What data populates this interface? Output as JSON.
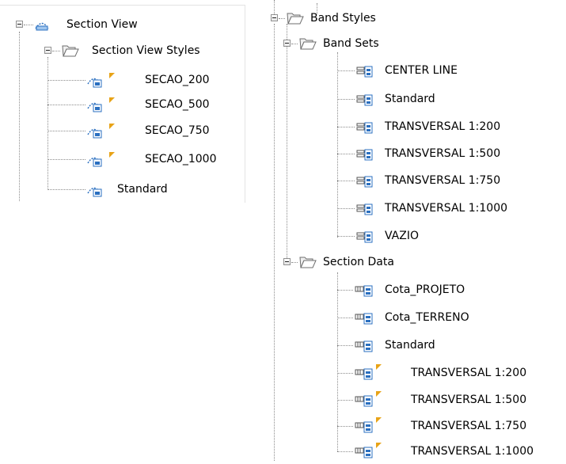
{
  "left_tree": {
    "root": {
      "label": "Section View",
      "icon": "section-view-icon"
    },
    "styles_folder": {
      "label": "Section View Styles",
      "icon": "folder-open-icon"
    },
    "styles": [
      {
        "label": "SECAO_200",
        "modified": true
      },
      {
        "label": "SECAO_500",
        "modified": true
      },
      {
        "label": "SECAO_750",
        "modified": true
      },
      {
        "label": "SECAO_1000",
        "modified": true
      },
      {
        "label": "Standard",
        "modified": false
      }
    ]
  },
  "right_tree": {
    "root": {
      "label": "Band Styles",
      "icon": "folder-open-icon"
    },
    "band_sets": {
      "label": "Band Sets",
      "items": [
        "CENTER LINE",
        "Standard",
        "TRANSVERSAL 1:200",
        "TRANSVERSAL 1:500",
        "TRANSVERSAL 1:750",
        "TRANSVERSAL 1:1000",
        "VAZIO"
      ]
    },
    "section_data": {
      "label": "Section Data",
      "items": [
        {
          "label": "Cota_PROJETO",
          "modified": false
        },
        {
          "label": "Cota_TERRENO",
          "modified": false
        },
        {
          "label": "Standard",
          "modified": false
        },
        {
          "label": "TRANSVERSAL 1:200",
          "modified": true
        },
        {
          "label": "TRANSVERSAL 1:500",
          "modified": true
        },
        {
          "label": "TRANSVERSAL 1:750",
          "modified": true
        },
        {
          "label": "TRANSVERSAL 1:1000",
          "modified": true
        }
      ]
    }
  },
  "colors": {
    "modified_flag": "#e8a317",
    "icon_blue": "#2a6fc0",
    "folder": "#6e6e6e",
    "tree_line": "#8c8c8c"
  }
}
